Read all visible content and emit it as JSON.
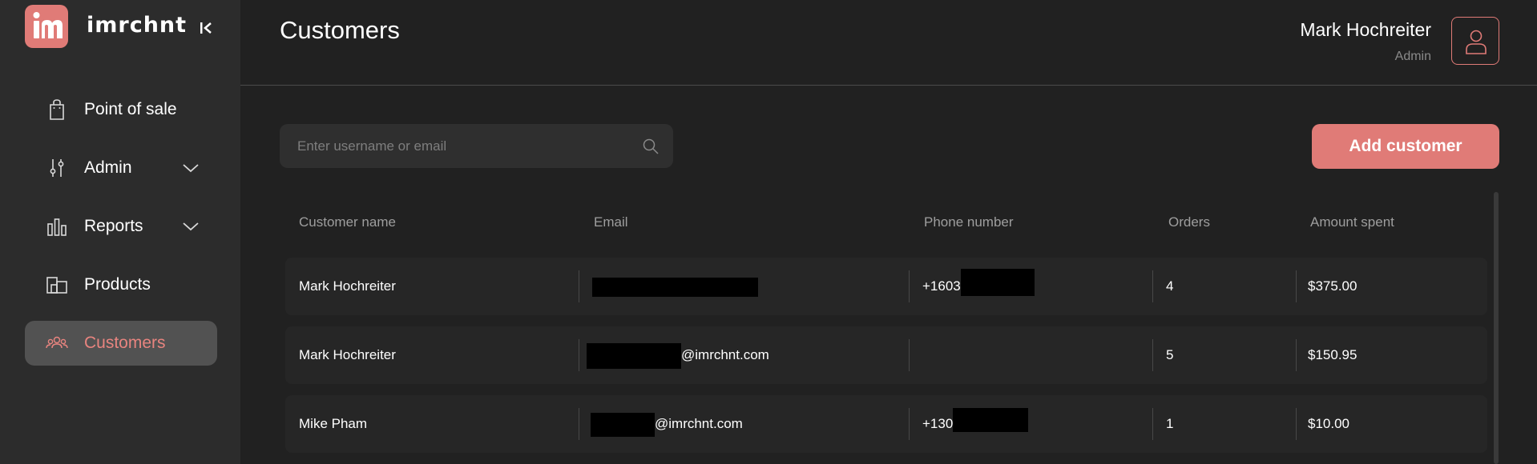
{
  "brand": {
    "name": "imrchnt",
    "logo_letters": "im",
    "accent": "#e07b77"
  },
  "sidebar": {
    "items": [
      {
        "label": "Point of sale",
        "icon": "shopping-bag-icon",
        "has_submenu": false,
        "active": false
      },
      {
        "label": "Admin",
        "icon": "sliders-icon",
        "has_submenu": true,
        "active": false
      },
      {
        "label": "Reports",
        "icon": "bar-chart-icon",
        "has_submenu": true,
        "active": false
      },
      {
        "label": "Products",
        "icon": "boxes-icon",
        "has_submenu": false,
        "active": false
      },
      {
        "label": "Customers",
        "icon": "users-icon",
        "has_submenu": false,
        "active": true
      }
    ]
  },
  "header": {
    "title": "Customers",
    "user": {
      "name": "Mark Hochreiter",
      "role": "Admin"
    }
  },
  "search": {
    "placeholder": "Enter username or email",
    "value": ""
  },
  "actions": {
    "add_customer_label": "Add customer"
  },
  "table": {
    "columns": [
      "Customer name",
      "Email",
      "Phone number",
      "Orders",
      "Amount spent"
    ],
    "rows": [
      {
        "name": "Mark Hochreiter",
        "email_visible": "",
        "phone_visible": "+1603",
        "orders": "4",
        "amount": "$375.00"
      },
      {
        "name": "Mark Hochreiter",
        "email_visible": "@imrchnt.com",
        "phone_visible": "",
        "orders": "5",
        "amount": "$150.95"
      },
      {
        "name": "Mike Pham",
        "email_visible": "@imrchnt.com",
        "phone_visible": "+130",
        "orders": "1",
        "amount": "$10.00"
      }
    ]
  }
}
